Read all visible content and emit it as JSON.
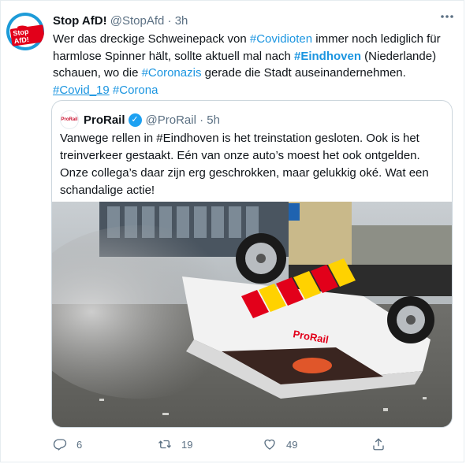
{
  "tweet": {
    "display_name": "Stop AfD!",
    "handle": "@StopAfd",
    "separator": "·",
    "time": "3h",
    "avatar_text": "Stop AfD!",
    "text_1": "Wer das dreckige Schweinepack von ",
    "hashtag_covidioten": "#Covidioten",
    "text_2": " immer noch lediglich für harmlose Spinner hält, sollte aktuell mal nach ",
    "hashtag_eindhoven": "#Eindhoven",
    "text_3": " (Niederlande) schauen, wo die ",
    "hashtag_coronazis": "#Coronazis",
    "text_4": " gerade die Stadt auseinandernehmen.",
    "hashtag_covid19": "#Covid_19",
    "hashtag_corona": "#Corona"
  },
  "quote": {
    "avatar_text": "ProRail",
    "display_name": "ProRail",
    "verified_mark": "✓",
    "handle": "@ProRail",
    "separator": "·",
    "time": "5h",
    "text": "Vanwege rellen in #Eindhoven is het treinstation gesloten. Ook is het treinverkeer gestaakt. Eén van onze auto’s moest het ook ontgelden. Onze collega’s daar zijn erg geschrokken, maar gelukkig oké. Wat een schandalige actie!",
    "photo_car_text": "ProRail"
  },
  "actions": {
    "reply_count": "6",
    "retweet_count": "19",
    "like_count": "49"
  },
  "icons": {
    "more": "more-icon",
    "reply": "reply-icon",
    "retweet": "retweet-icon",
    "like": "like-icon",
    "share": "share-icon"
  },
  "colors": {
    "link": "#1b95e0",
    "verified": "#1da1f2",
    "meta": "#5b7083",
    "brand_red": "#e2001a"
  }
}
